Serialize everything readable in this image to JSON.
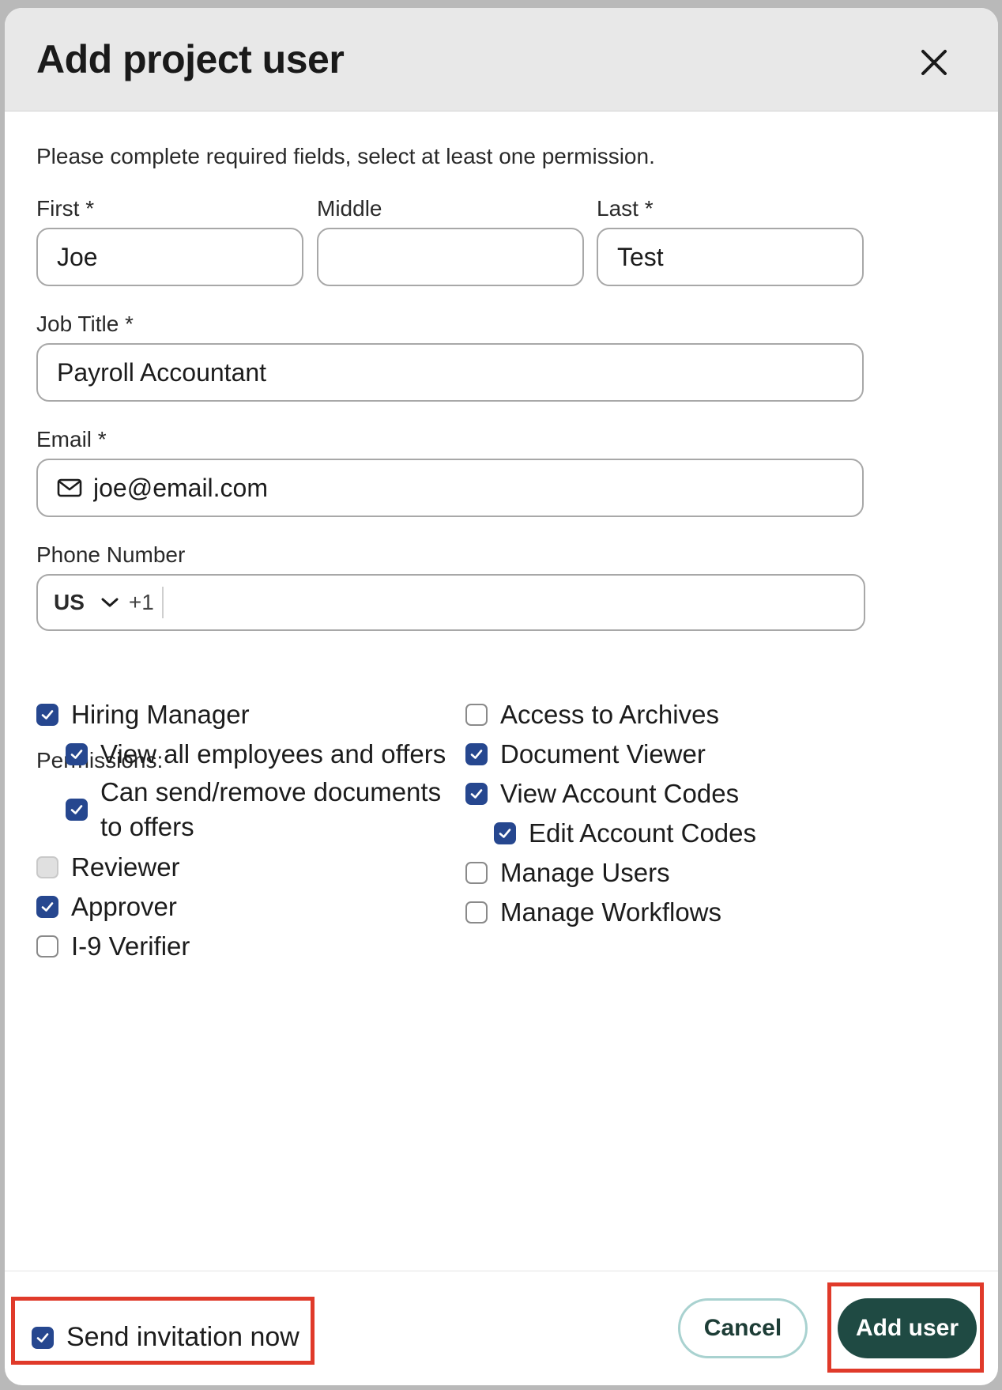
{
  "dialog": {
    "title": "Add project user",
    "intro": "Please complete required fields, select at least one permission."
  },
  "form": {
    "first": {
      "label": "First *",
      "value": "Joe"
    },
    "middle": {
      "label": "Middle",
      "value": ""
    },
    "last": {
      "label": "Last *",
      "value": "Test"
    },
    "job_title": {
      "label": "Job Title *",
      "value": "Payroll Accountant"
    },
    "email": {
      "label": "Email *",
      "value": "joe@email.com",
      "icon": "mail-icon"
    },
    "phone": {
      "label": "Phone Number",
      "country": "US",
      "dial_code": "+1",
      "value": ""
    }
  },
  "permissions": {
    "title": "Permissions:",
    "left": [
      {
        "label": "Hiring Manager",
        "checked": true
      },
      {
        "label": "View all employees and offers",
        "checked": true
      },
      {
        "label": "Can send/remove documents to offers",
        "checked": true
      },
      {
        "label": "Reviewer",
        "checked": false,
        "disabled": true
      },
      {
        "label": "Approver",
        "checked": true
      },
      {
        "label": "I-9 Verifier",
        "checked": false
      }
    ],
    "right": [
      {
        "label": "Access to Archives",
        "checked": false
      },
      {
        "label": "Document Viewer",
        "checked": true
      },
      {
        "label": "View Account Codes",
        "checked": true
      },
      {
        "label": "Edit Account Codes",
        "checked": true
      },
      {
        "label": "Manage Users",
        "checked": false
      },
      {
        "label": "Manage Workflows",
        "checked": false
      }
    ]
  },
  "footer": {
    "send_invitation": {
      "label": "Send invitation now",
      "checked": true
    },
    "cancel_label": "Cancel",
    "add_label": "Add user"
  },
  "colors": {
    "checkbox_checked": "#26478f",
    "primary_button": "#1f4a43",
    "cancel_border": "#a9d2d0",
    "highlight": "#e03a2a"
  }
}
